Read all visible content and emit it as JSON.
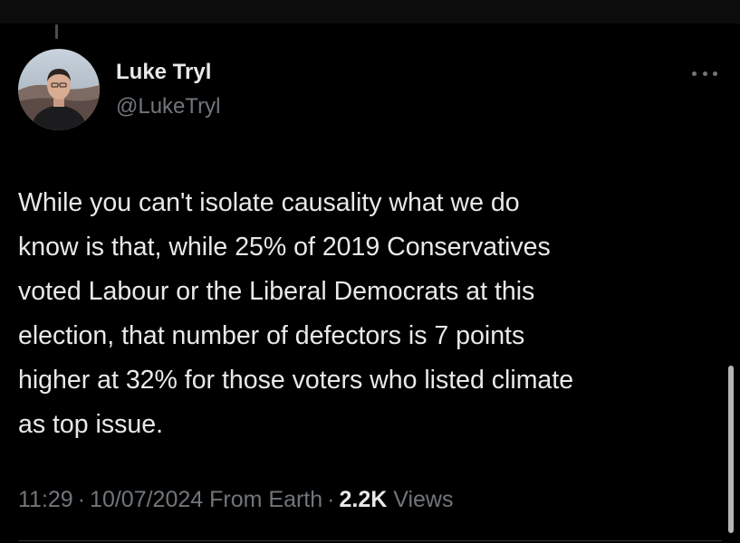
{
  "tweet": {
    "author": {
      "display_name": "Luke Tryl",
      "handle": "@LukeTryl"
    },
    "text_lines": [
      "While you can't isolate causality what we do",
      "know is that, while 25% of 2019 Conservatives",
      "voted Labour or the Liberal Democrats at this",
      "election, that number of defectors is 7 points",
      "higher at 32% for those voters who listed climate",
      "as top issue."
    ],
    "meta": {
      "time": "11:29",
      "date": "10/07/2024",
      "source": "From Earth",
      "separator": "·",
      "views_count": "2.2K",
      "views_label": "Views"
    },
    "more_icon": "ellipsis-horizontal-icon"
  },
  "colors": {
    "background": "#000000",
    "primary_text": "#e7e9ea",
    "secondary_text": "#71767b"
  }
}
